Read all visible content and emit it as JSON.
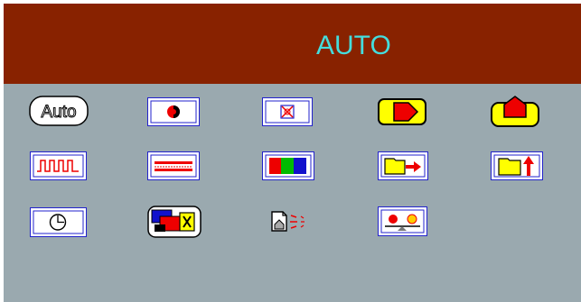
{
  "osd": {
    "title": "AUTO",
    "colors": {
      "header_bg": "#882200",
      "title_text": "#44dddd",
      "panel_bg": "#9aa9af",
      "icon_border": "#2222cc"
    },
    "icons": {
      "auto_label": "Auto",
      "rows": [
        [
          "auto-adjust-icon",
          "contrast-icon",
          "degauss-icon",
          "position-left-icon",
          "position-up-icon"
        ],
        [
          "clock-phase-icon",
          "focus-icon",
          "color-bars-icon",
          "h-position-icon",
          "v-position-icon"
        ],
        [
          "timer-icon",
          "exit-icon",
          "recall-icon",
          "color-temperature-icon"
        ]
      ]
    }
  }
}
